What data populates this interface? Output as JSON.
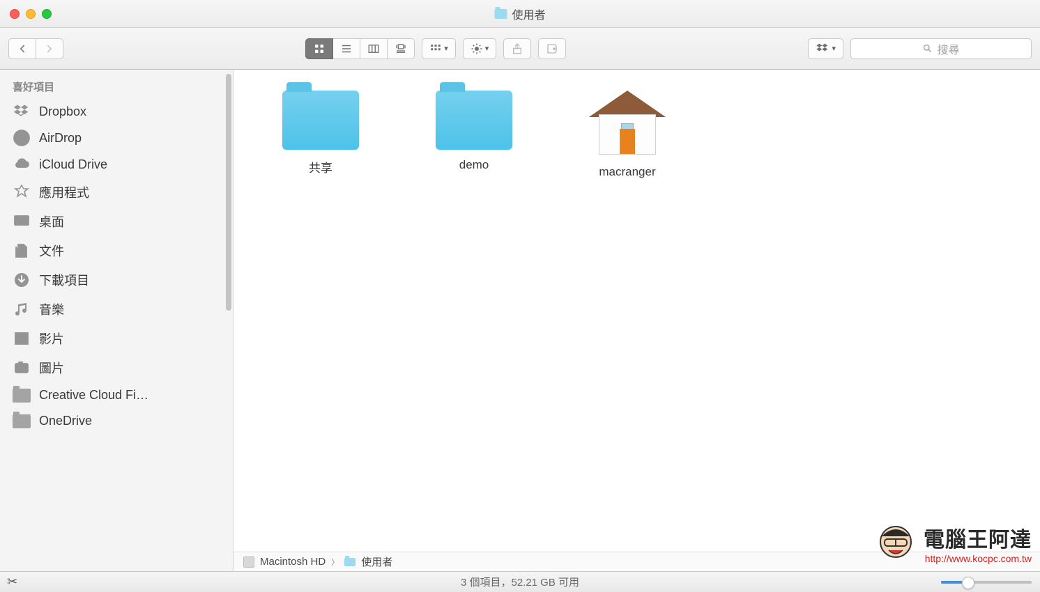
{
  "window": {
    "title": "使用者"
  },
  "toolbar": {
    "search_placeholder": "搜尋"
  },
  "sidebar": {
    "header": "喜好項目",
    "items": [
      {
        "label": "Dropbox",
        "icon": "dropbox"
      },
      {
        "label": "AirDrop",
        "icon": "airdrop"
      },
      {
        "label": "iCloud Drive",
        "icon": "cloud"
      },
      {
        "label": "應用程式",
        "icon": "apps"
      },
      {
        "label": "桌面",
        "icon": "desktop"
      },
      {
        "label": "文件",
        "icon": "documents"
      },
      {
        "label": "下載項目",
        "icon": "downloads"
      },
      {
        "label": "音樂",
        "icon": "music"
      },
      {
        "label": "影片",
        "icon": "movies"
      },
      {
        "label": "圖片",
        "icon": "pictures"
      },
      {
        "label": "Creative Cloud Fi…",
        "icon": "folder"
      },
      {
        "label": "OneDrive",
        "icon": "folder"
      }
    ]
  },
  "content": {
    "items": [
      {
        "label": "共享",
        "type": "folder"
      },
      {
        "label": "demo",
        "type": "folder"
      },
      {
        "label": "macranger",
        "type": "home"
      }
    ]
  },
  "pathbar": {
    "segments": [
      {
        "label": "Macintosh HD",
        "icon": "disk"
      },
      {
        "label": "使用者",
        "icon": "folder"
      }
    ]
  },
  "statusbar": {
    "text": "3 個項目，52.21 GB 可用"
  },
  "watermark": {
    "title": "電腦王阿達",
    "url": "http://www.kocpc.com.tw"
  }
}
